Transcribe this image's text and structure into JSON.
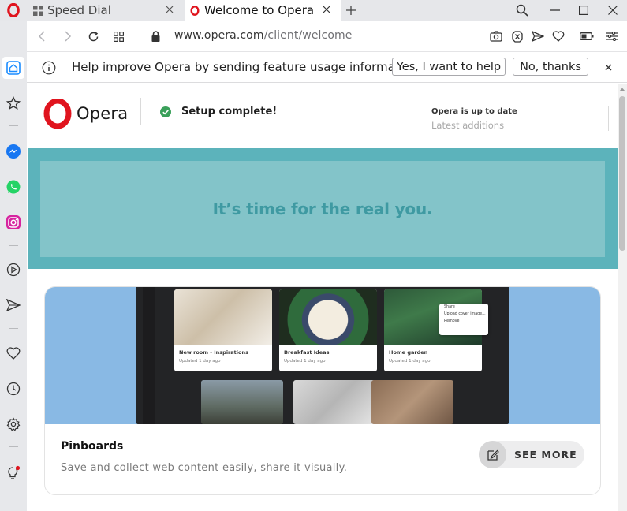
{
  "tabs": [
    {
      "label": "Speed Dial",
      "icon": "grid-icon"
    },
    {
      "label": "Welcome to Opera",
      "icon": "opera-icon"
    }
  ],
  "address": {
    "domain": "www.opera.com",
    "path": "/client/welcome"
  },
  "infobar": {
    "text": "Help improve Opera by sending feature usage information",
    "accept_label": "Yes, I want to help",
    "decline_label": "No, thanks"
  },
  "page": {
    "brand": "Opera",
    "setup_text": "Setup complete!",
    "status_text": "Opera is up to date",
    "latest_label": "Latest additions",
    "banner_text": "It’s time for the real you."
  },
  "card": {
    "title": "Pinboards",
    "description": "Save and collect web content easily, share it visually.",
    "button_label": "SEE MORE",
    "pins": [
      {
        "title": "New room - Inspirations",
        "meta": "Updated 1 day ago"
      },
      {
        "title": "Breakfast Ideas",
        "meta": "Updated 1 day ago"
      },
      {
        "title": "Home garden",
        "meta": "Updated 1 day ago"
      }
    ],
    "menu_items": [
      "Share",
      "Upload cover image...",
      "Remove"
    ]
  },
  "colors": {
    "opera_red": "#e0141e",
    "banner_outer": "#5cb3bb",
    "banner_inner": "#83c4c9",
    "banner_text": "#3f9aa2",
    "sidebar_active": "#1a8cff",
    "messenger": "#1877f2",
    "whatsapp": "#25d366",
    "instagram": "#d6249f",
    "check_green": "#3aa05a"
  }
}
